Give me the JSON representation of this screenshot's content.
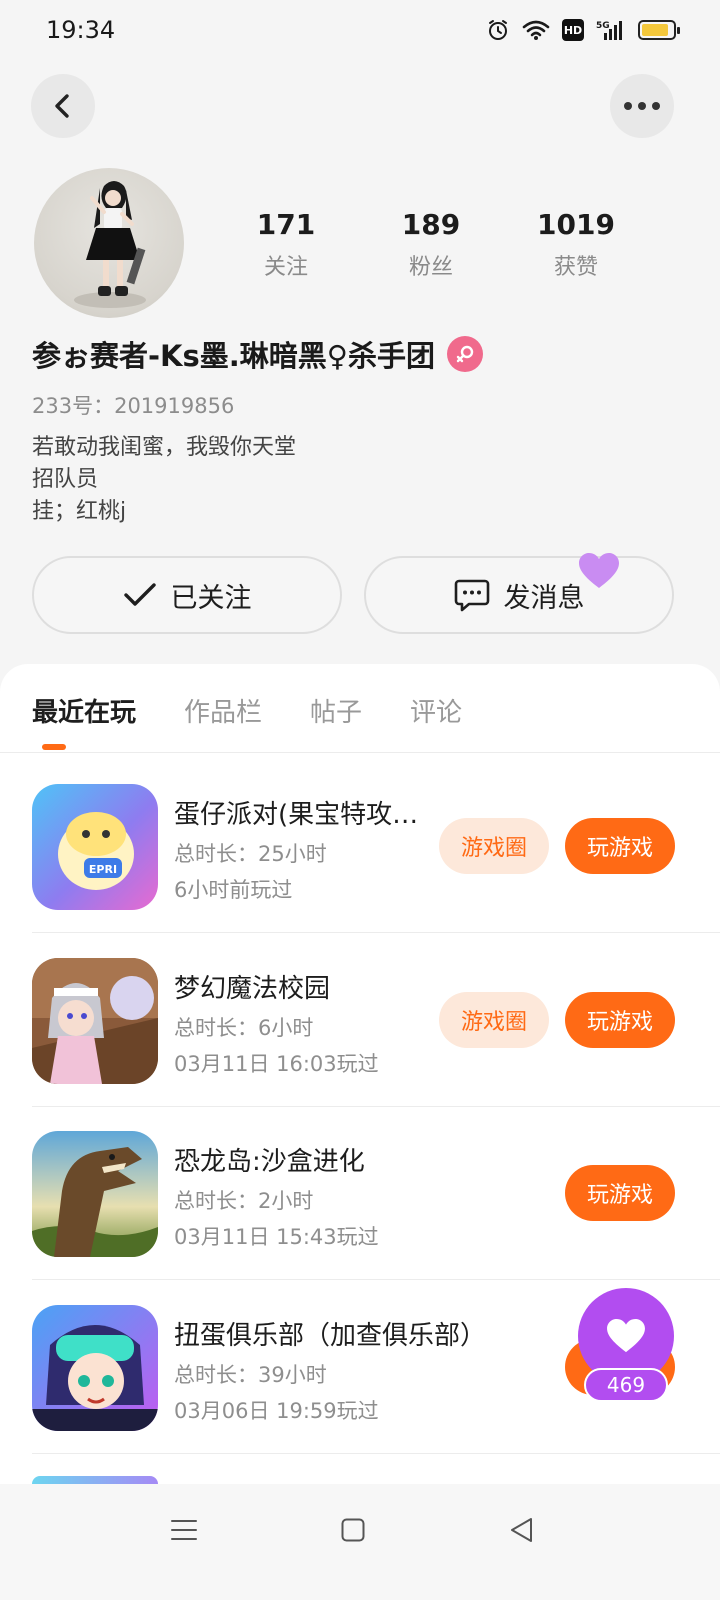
{
  "status_bar": {
    "time": "19:34",
    "network_label": "5G",
    "hd_label": "HD",
    "battery_level": 0.85
  },
  "header": {
    "back_icon": "chevron-left-icon",
    "more_icon": "more-dots-icon"
  },
  "profile": {
    "stats": [
      {
        "value": "171",
        "label": "关注"
      },
      {
        "value": "189",
        "label": "粉丝"
      },
      {
        "value": "1019",
        "label": "获赞"
      }
    ],
    "username": "参ぉ赛者-Ks墨.琳暗黑♀杀手团",
    "gender_icon": "female-icon",
    "uid": "233号：201919856",
    "bio": [
      "若敢动我闺蜜，我毁你天堂",
      "招队员",
      "挂；红桃j"
    ]
  },
  "actions": {
    "follow_label": "已关注",
    "message_label": "发消息"
  },
  "tabs": [
    {
      "label": "最近在玩",
      "active": true
    },
    {
      "label": "作品栏",
      "active": false
    },
    {
      "label": "帖子",
      "active": false
    },
    {
      "label": "评论",
      "active": false
    }
  ],
  "games": [
    {
      "name": "蛋仔派对(果宝特攻…",
      "duration": "总时长：25小时",
      "last_played": "6小时前玩过",
      "circle_label": "游戏圈",
      "play_label": "玩游戏"
    },
    {
      "name": "梦幻魔法校园",
      "duration": "总时长：6小时",
      "last_played": "03月11日 16:03玩过",
      "circle_label": "游戏圈",
      "play_label": "玩游戏"
    },
    {
      "name": "恐龙岛:沙盒进化",
      "duration": "总时长：2小时",
      "last_played": "03月11日 15:43玩过",
      "play_label": "玩游戏"
    },
    {
      "name": "扭蛋俱乐部（加查俱乐部）",
      "duration": "总时长：39小时",
      "last_played": "03月06日 19:59玩过"
    }
  ],
  "floating_like": {
    "count": "469"
  },
  "colors": {
    "accent": "#ff6a15",
    "accent_light": "#fde8da",
    "like_purple": "#b24df0",
    "gender_pink": "#f06a8c"
  }
}
